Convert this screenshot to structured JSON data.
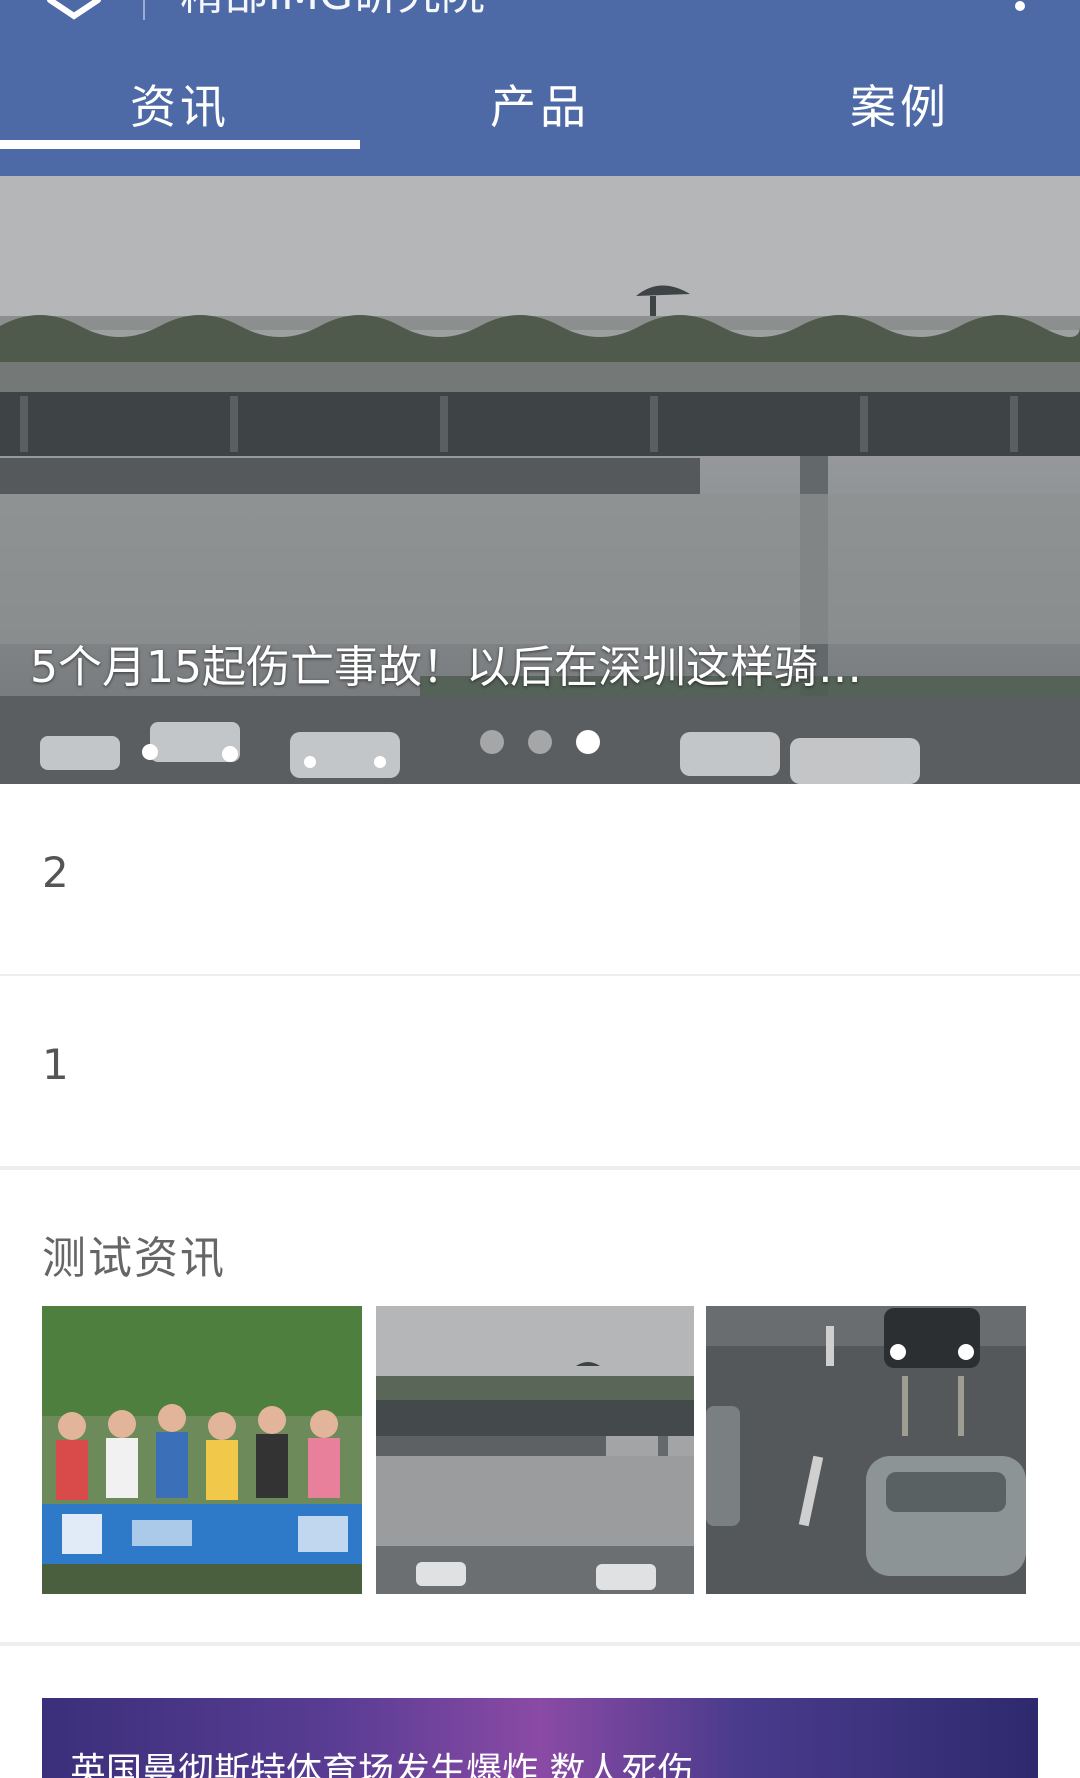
{
  "header": {
    "title": "精部IMG研究院",
    "tabs": [
      {
        "label": "资讯",
        "active": true
      },
      {
        "label": "产品",
        "active": false
      },
      {
        "label": "案例",
        "active": false
      }
    ],
    "background_color": "#4d6aa6"
  },
  "banner": {
    "caption": "5个月15起伤亡事故！以后在深圳这样骑…",
    "slides_total": 3,
    "active_slide": 3
  },
  "list": {
    "items": [
      {
        "label": "2"
      },
      {
        "label": "1"
      }
    ]
  },
  "section": {
    "title": "测试资讯"
  },
  "bottom_card": {
    "title": "英国曼彻斯特体育场发生爆炸 数人死伤"
  }
}
